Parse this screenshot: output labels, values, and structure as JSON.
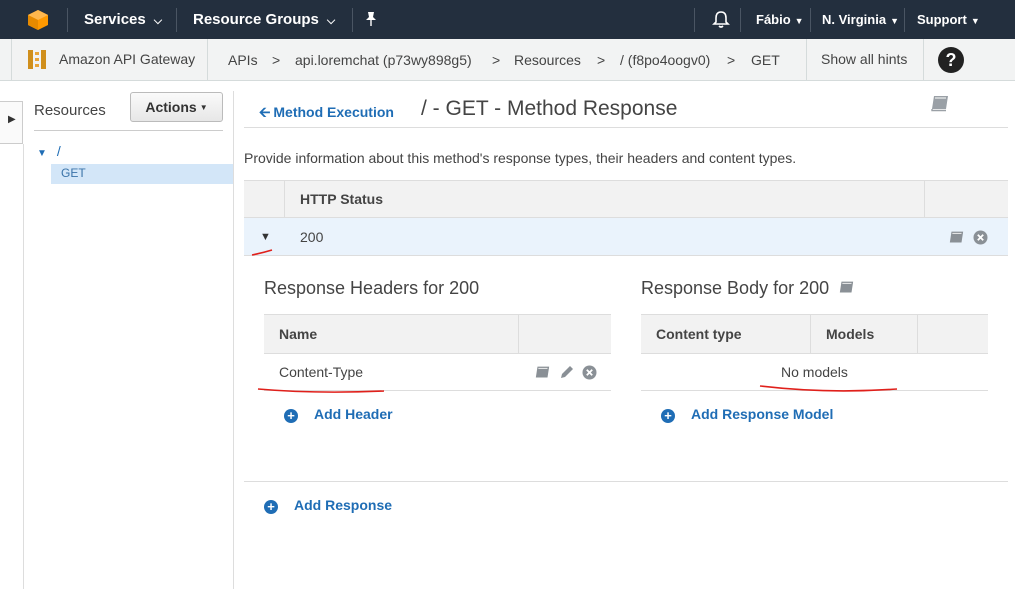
{
  "topnav": {
    "services": "Services",
    "resource_groups": "Resource Groups",
    "user": "Fábio",
    "region": "N. Virginia",
    "support": "Support"
  },
  "breadcrumb": {
    "service": "Amazon API Gateway",
    "apis": "APIs",
    "api": "api.loremchat (p73wy898g5)",
    "resources": "Resources",
    "resource": "/ (f8po4oogv0)",
    "method": "GET",
    "sep": ">",
    "show_hints": "Show all hints",
    "help": "?"
  },
  "sidebar": {
    "title": "Resources",
    "actions": "Actions",
    "root": "/",
    "method": "GET"
  },
  "main": {
    "back_link": "Method Execution",
    "title": "/ - GET - Method Response",
    "description": "Provide information about this method's response types, their headers and content types.",
    "status_header": "HTTP Status",
    "status_code": "200"
  },
  "headers_section": {
    "title": "Response Headers for 200",
    "col_name": "Name",
    "row_name": "Content-Type",
    "add_label": "Add Header"
  },
  "body_section": {
    "title": "Response Body for 200",
    "col_content_type": "Content type",
    "col_models": "Models",
    "empty": "No models",
    "add_label": "Add Response Model"
  },
  "add_response": "Add Response",
  "colors": {
    "nav_bg": "#232f3e",
    "link": "#1f6db5",
    "selected_row": "#eaf3fc",
    "annotation": "#e0201b"
  }
}
